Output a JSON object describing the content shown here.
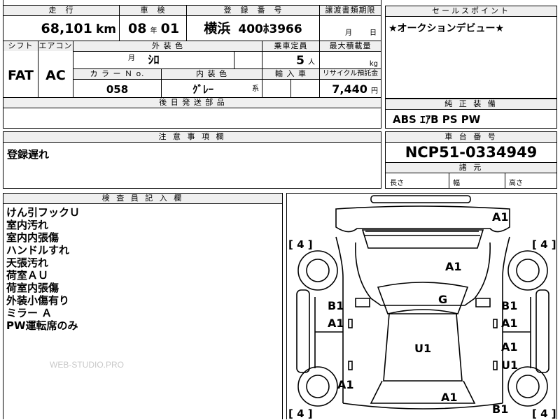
{
  "top": {
    "headers": {
      "mileage": "走　行",
      "inspection": "車　検",
      "registration": "登　録　番　号",
      "transfer_deadline": "譲渡書類期限"
    },
    "mileage_value": "68,101",
    "mileage_unit": "km",
    "inspection_year": "08",
    "inspection_year_unit": "年",
    "inspection_month": "01",
    "inspection_month_unit": "月",
    "plate_region": "横浜",
    "plate_number": "400ﾎ3966",
    "transfer_month_unit": "月",
    "transfer_day_unit": "日"
  },
  "specs": {
    "shift_label": "シフト",
    "aircon_label": "エアコン",
    "exterior_color_label": "外 装 色",
    "capacity_label": "乗車定員",
    "max_load_label": "最大積載量",
    "shift_value": "FAT",
    "aircon_value": "AC",
    "exterior_color_value": "ｼﾛ",
    "capacity_value": "5",
    "capacity_unit": "人",
    "max_load_unit": "kg",
    "color_no_label": "カ ラ ー Ｎ o.",
    "interior_color_label": "内 装 色",
    "import_label": "輸 入 車",
    "recycle_label": "リサイクル預託金",
    "color_no_value": "058",
    "interior_color_value": "ｸﾞﾚｰ",
    "interior_color_suffix": "系",
    "recycle_value": "7,440",
    "recycle_unit": "円",
    "later_parts_label": "後 日 発 送 部 品"
  },
  "sales_point": {
    "header": "セールスポイント",
    "text": "★オークションデビュー★"
  },
  "equipment": {
    "header": "純 正 装 備",
    "text": "ABS ｴｱB PS PW"
  },
  "notes": {
    "header": "注 意 事 項 欄",
    "text": "登録遅れ"
  },
  "chassis": {
    "header": "車 台 番 号",
    "value": "NCP51-0334949",
    "dims_header": "諸 元",
    "length_label": "長さ",
    "width_label": "幅",
    "height_label": "高さ"
  },
  "inspector": {
    "header": "検 査 員 記 入 欄",
    "items": [
      "けん引フックＵ",
      "室内汚れ",
      "室内内張傷",
      "ハンドルすれ",
      "天張汚れ",
      "荷室ＡＵ",
      "荷室内張傷",
      "外装小傷有り",
      "ミラー Ａ",
      "PW運転席のみ"
    ],
    "watermark": "WEB-STUDIO.PRO"
  },
  "diagram": {
    "tires": [
      "[ 4 ]",
      "[ 4 ]",
      "[ 4 ]",
      "[ 4 ]"
    ],
    "marks": {
      "front_bumper": "A1",
      "hood": "A1",
      "windshield": "G",
      "left_front_fender_1": "B1",
      "left_front_fender_2": "A1",
      "right_front_fender_1": "B1",
      "right_front_fender_2": "A1",
      "roof": "U1",
      "right_rear_door_1": "A1",
      "right_rear_door_2": "U1",
      "left_rear_quarter": "A1",
      "rear_panel": "A1",
      "rear_bumper": "B1"
    }
  }
}
